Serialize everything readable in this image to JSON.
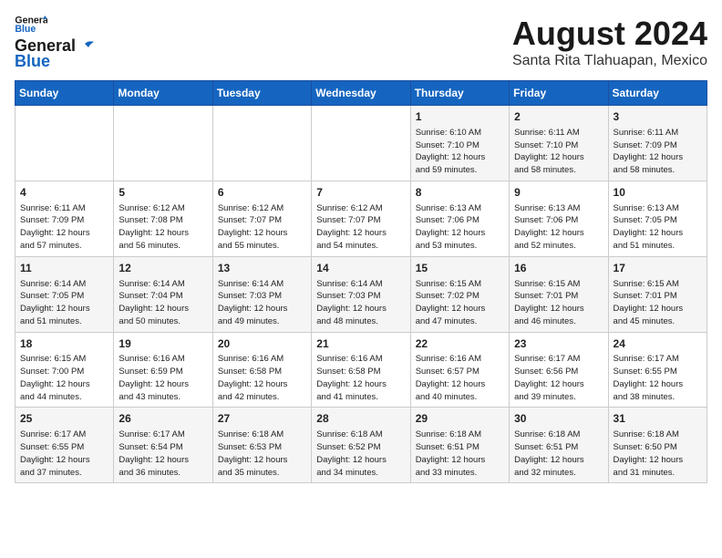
{
  "header": {
    "logo_line1": "General",
    "logo_line2": "Blue",
    "month_year": "August 2024",
    "location": "Santa Rita Tlahuapan, Mexico"
  },
  "weekdays": [
    "Sunday",
    "Monday",
    "Tuesday",
    "Wednesday",
    "Thursday",
    "Friday",
    "Saturday"
  ],
  "weeks": [
    [
      {
        "day": "",
        "info": ""
      },
      {
        "day": "",
        "info": ""
      },
      {
        "day": "",
        "info": ""
      },
      {
        "day": "",
        "info": ""
      },
      {
        "day": "1",
        "info": "Sunrise: 6:10 AM\nSunset: 7:10 PM\nDaylight: 12 hours\nand 59 minutes."
      },
      {
        "day": "2",
        "info": "Sunrise: 6:11 AM\nSunset: 7:10 PM\nDaylight: 12 hours\nand 58 minutes."
      },
      {
        "day": "3",
        "info": "Sunrise: 6:11 AM\nSunset: 7:09 PM\nDaylight: 12 hours\nand 58 minutes."
      }
    ],
    [
      {
        "day": "4",
        "info": "Sunrise: 6:11 AM\nSunset: 7:09 PM\nDaylight: 12 hours\nand 57 minutes."
      },
      {
        "day": "5",
        "info": "Sunrise: 6:12 AM\nSunset: 7:08 PM\nDaylight: 12 hours\nand 56 minutes."
      },
      {
        "day": "6",
        "info": "Sunrise: 6:12 AM\nSunset: 7:07 PM\nDaylight: 12 hours\nand 55 minutes."
      },
      {
        "day": "7",
        "info": "Sunrise: 6:12 AM\nSunset: 7:07 PM\nDaylight: 12 hours\nand 54 minutes."
      },
      {
        "day": "8",
        "info": "Sunrise: 6:13 AM\nSunset: 7:06 PM\nDaylight: 12 hours\nand 53 minutes."
      },
      {
        "day": "9",
        "info": "Sunrise: 6:13 AM\nSunset: 7:06 PM\nDaylight: 12 hours\nand 52 minutes."
      },
      {
        "day": "10",
        "info": "Sunrise: 6:13 AM\nSunset: 7:05 PM\nDaylight: 12 hours\nand 51 minutes."
      }
    ],
    [
      {
        "day": "11",
        "info": "Sunrise: 6:14 AM\nSunset: 7:05 PM\nDaylight: 12 hours\nand 51 minutes."
      },
      {
        "day": "12",
        "info": "Sunrise: 6:14 AM\nSunset: 7:04 PM\nDaylight: 12 hours\nand 50 minutes."
      },
      {
        "day": "13",
        "info": "Sunrise: 6:14 AM\nSunset: 7:03 PM\nDaylight: 12 hours\nand 49 minutes."
      },
      {
        "day": "14",
        "info": "Sunrise: 6:14 AM\nSunset: 7:03 PM\nDaylight: 12 hours\nand 48 minutes."
      },
      {
        "day": "15",
        "info": "Sunrise: 6:15 AM\nSunset: 7:02 PM\nDaylight: 12 hours\nand 47 minutes."
      },
      {
        "day": "16",
        "info": "Sunrise: 6:15 AM\nSunset: 7:01 PM\nDaylight: 12 hours\nand 46 minutes."
      },
      {
        "day": "17",
        "info": "Sunrise: 6:15 AM\nSunset: 7:01 PM\nDaylight: 12 hours\nand 45 minutes."
      }
    ],
    [
      {
        "day": "18",
        "info": "Sunrise: 6:15 AM\nSunset: 7:00 PM\nDaylight: 12 hours\nand 44 minutes."
      },
      {
        "day": "19",
        "info": "Sunrise: 6:16 AM\nSunset: 6:59 PM\nDaylight: 12 hours\nand 43 minutes."
      },
      {
        "day": "20",
        "info": "Sunrise: 6:16 AM\nSunset: 6:58 PM\nDaylight: 12 hours\nand 42 minutes."
      },
      {
        "day": "21",
        "info": "Sunrise: 6:16 AM\nSunset: 6:58 PM\nDaylight: 12 hours\nand 41 minutes."
      },
      {
        "day": "22",
        "info": "Sunrise: 6:16 AM\nSunset: 6:57 PM\nDaylight: 12 hours\nand 40 minutes."
      },
      {
        "day": "23",
        "info": "Sunrise: 6:17 AM\nSunset: 6:56 PM\nDaylight: 12 hours\nand 39 minutes."
      },
      {
        "day": "24",
        "info": "Sunrise: 6:17 AM\nSunset: 6:55 PM\nDaylight: 12 hours\nand 38 minutes."
      }
    ],
    [
      {
        "day": "25",
        "info": "Sunrise: 6:17 AM\nSunset: 6:55 PM\nDaylight: 12 hours\nand 37 minutes."
      },
      {
        "day": "26",
        "info": "Sunrise: 6:17 AM\nSunset: 6:54 PM\nDaylight: 12 hours\nand 36 minutes."
      },
      {
        "day": "27",
        "info": "Sunrise: 6:18 AM\nSunset: 6:53 PM\nDaylight: 12 hours\nand 35 minutes."
      },
      {
        "day": "28",
        "info": "Sunrise: 6:18 AM\nSunset: 6:52 PM\nDaylight: 12 hours\nand 34 minutes."
      },
      {
        "day": "29",
        "info": "Sunrise: 6:18 AM\nSunset: 6:51 PM\nDaylight: 12 hours\nand 33 minutes."
      },
      {
        "day": "30",
        "info": "Sunrise: 6:18 AM\nSunset: 6:51 PM\nDaylight: 12 hours\nand 32 minutes."
      },
      {
        "day": "31",
        "info": "Sunrise: 6:18 AM\nSunset: 6:50 PM\nDaylight: 12 hours\nand 31 minutes."
      }
    ]
  ]
}
